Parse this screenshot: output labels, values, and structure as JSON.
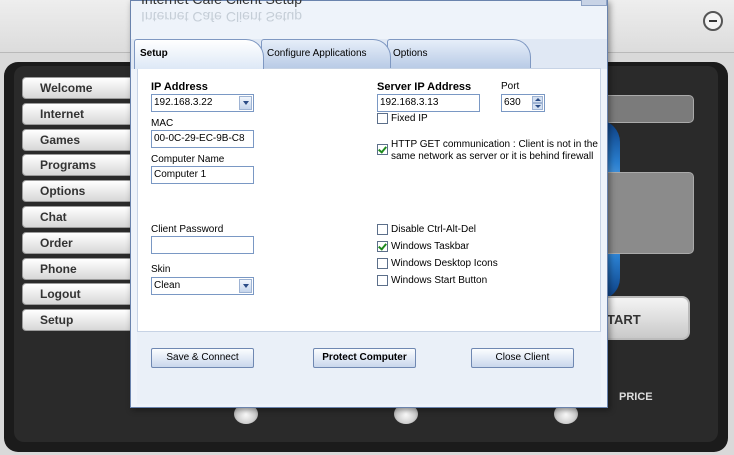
{
  "dialog": {
    "title": "Internet Cafe Client Setup",
    "tabs": [
      "Setup",
      "Configure Applications",
      "Options"
    ],
    "ip_label": "IP Address",
    "ip_value": "192.168.3.22",
    "mac_label": "MAC",
    "mac_value": "00-0C-29-EC-9B-C8",
    "computer_name_label": "Computer Name",
    "computer_name_value": "Computer 1",
    "server_ip_label": "Server IP Address",
    "server_ip_value": "192.168.3.13",
    "port_label": "Port",
    "port_value": "630",
    "fixed_ip_label": "Fixed IP",
    "http_get_label_1": "HTTP GET communication : Client is not in the",
    "http_get_label_2": "same network as server or it is behind firewall",
    "client_password_label": "Client Password",
    "client_password_value": "",
    "skin_label": "Skin",
    "skin_value": "Clean",
    "disable_cad_label": "Disable Ctrl-Alt-Del",
    "windows_taskbar_label": "Windows Taskbar",
    "desktop_icons_label": "Windows Desktop Icons",
    "start_button_label": "Windows Start Button",
    "save_connect": "Save & Connect",
    "protect_computer": "Protect Computer",
    "close_client": "Close Client"
  },
  "checkboxes": {
    "fixed_ip": false,
    "http_get": true,
    "disable_cad": false,
    "windows_taskbar": true,
    "desktop_icons": false,
    "start_button": false
  },
  "background": {
    "sidebar": [
      "Welcome",
      "Internet",
      "Games",
      "Programs",
      "Options",
      "Chat",
      "Order",
      "Phone",
      "Logout",
      "Setup"
    ],
    "start_label": "TART",
    "price_label": "PRICE"
  }
}
